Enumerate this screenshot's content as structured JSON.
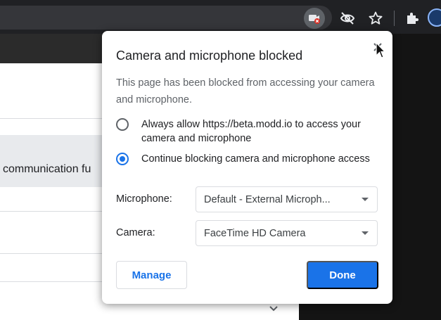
{
  "toolbar": {
    "icons": [
      "camera-blocked-icon",
      "eye-off-icon",
      "star-icon",
      "puzzle-icon",
      "profile-icon"
    ]
  },
  "page": {
    "visible_text": "communication fu"
  },
  "dialog": {
    "title": "Camera and microphone blocked",
    "description": "This page has been blocked from accessing your camera and microphone.",
    "options": [
      {
        "label": "Always allow https://beta.modd.io to access your camera and microphone",
        "selected": false
      },
      {
        "label": "Continue blocking camera and microphone access",
        "selected": true
      }
    ],
    "microphone": {
      "label": "Microphone:",
      "value": "Default - External Microph..."
    },
    "camera": {
      "label": "Camera:",
      "value": "FaceTime HD Camera"
    },
    "manage_label": "Manage",
    "done_label": "Done"
  },
  "colors": {
    "accent": "#1a73e8",
    "toolbar_bg": "#202124"
  }
}
